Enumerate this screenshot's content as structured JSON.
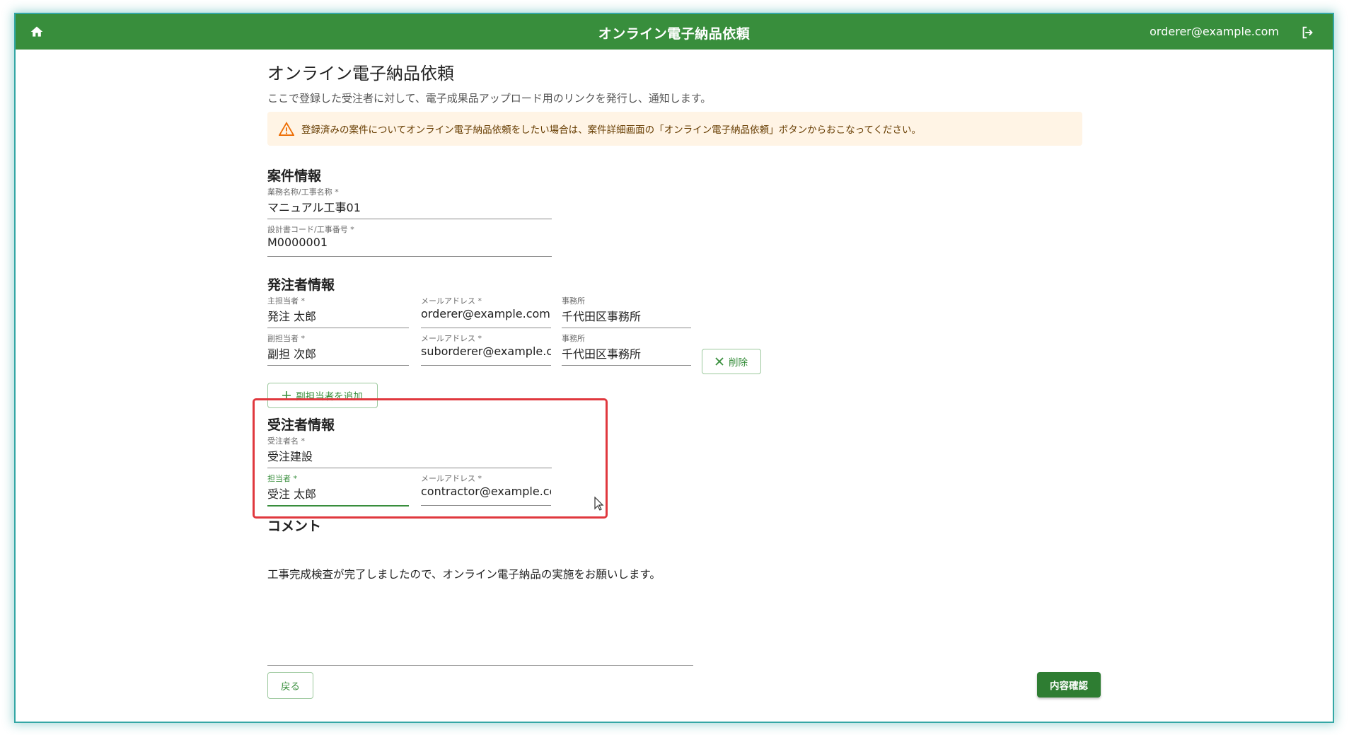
{
  "app": {
    "title": "オンライン電子納品依頼",
    "user_email": "orderer@example.com",
    "home_icon": "home-icon",
    "logout_icon": "logout-icon"
  },
  "page": {
    "title": "オンライン電子納品依頼",
    "description": "ここで登録した受注者に対して、電子成果品アップロード用のリンクを発行し、通知します。",
    "alert": "登録済みの案件についてオンライン電子納品依頼をしたい場合は、案件詳細画面の「オンライン電子納品依頼」ボタンからおこなってください。"
  },
  "project": {
    "section_title": "案件情報",
    "name_label": "業務名称/工事名称 *",
    "name_value": "マニュアル工事01",
    "code_label": "設計書コード/工事番号 *",
    "code_value": "M0000001"
  },
  "orderer": {
    "section_title": "発注者情報",
    "main": {
      "person_label": "主担当者 *",
      "person_value": "発注 太郎",
      "email_label": "メールアドレス *",
      "email_value": "orderer@example.com",
      "office_label": "事務所",
      "office_value": "千代田区事務所"
    },
    "sub": {
      "person_label": "副担当者 *",
      "person_value": "副担 次郎",
      "email_label": "メールアドレス *",
      "email_value": "suborderer@example.com",
      "office_label": "事務所",
      "office_value": "千代田区事務所",
      "delete_label": "削除"
    },
    "add_sub_label": "副担当者を追加"
  },
  "contractor": {
    "section_title": "受注者情報",
    "company_label": "受注者名 *",
    "company_value": "受注建設",
    "person_label": "担当者 *",
    "person_value": "受注 太郎",
    "email_label": "メールアドレス *",
    "email_value": "contractor@example.com"
  },
  "comment": {
    "section_title": "コメント",
    "value": "工事完成検査が完了しましたので、オンライン電子納品の実施をお願いします。"
  },
  "actions": {
    "back_label": "戻る",
    "confirm_label": "内容確認"
  },
  "colors": {
    "header": "#388e3c",
    "accent": "#2e7d32",
    "alert_bg": "#fff4e5",
    "highlight": "#e0383e"
  }
}
